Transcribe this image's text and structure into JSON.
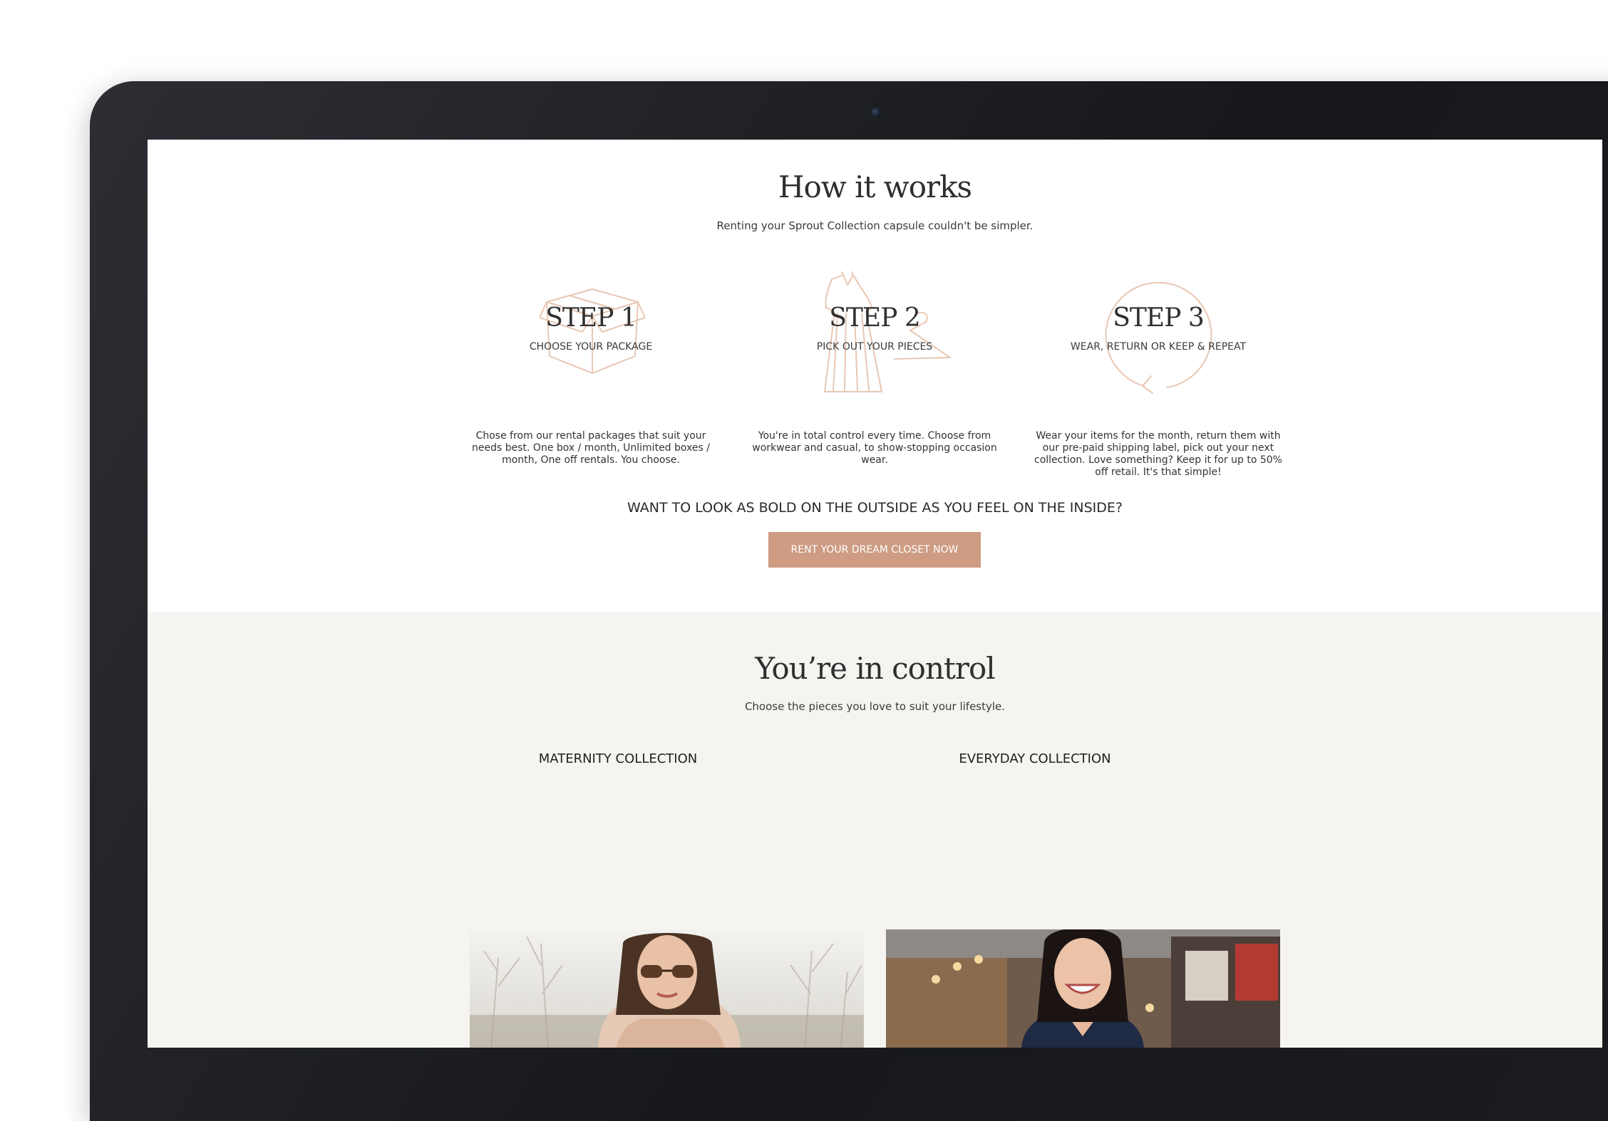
{
  "how_it_works": {
    "title": "How it works",
    "subtitle": "Renting your Sprout Collection capsule couldn't be simpler.",
    "steps": [
      {
        "heading": "STEP 1",
        "subheading": "CHOOSE YOUR PACKAGE",
        "icon": "box-icon",
        "description_lines": [
          "Chose from our rental packages that suit your",
          "needs best. One box / month, Unlimited boxes /",
          "month, One off rentals. You choose."
        ]
      },
      {
        "heading": "STEP 2",
        "subheading": "PICK OUT YOUR PIECES",
        "icon": "dress-icon",
        "description_lines": [
          "You're in total control every time. Choose from",
          "workwear and casual, to show-stopping occasion",
          "wear."
        ]
      },
      {
        "heading": "STEP 3",
        "subheading": "WEAR, RETURN OR KEEP & REPEAT",
        "icon": "cycle-arrow-icon",
        "description_lines": [
          "Wear your items for the month, return them with",
          "our pre-paid shipping label, pick out your next",
          "collection. Love something? Keep it for up to 50%",
          "off retail. It's that simple!"
        ]
      }
    ],
    "cta_question": "WANT TO LOOK AS BOLD ON THE OUTSIDE AS YOU FEEL ON THE INSIDE?",
    "cta_button": "RENT YOUR DREAM CLOSET NOW"
  },
  "control": {
    "title": "You’re in control",
    "subtitle": "Choose the pieces you love to suit your lifestyle.",
    "collections": [
      {
        "label": "MATERNITY COLLECTION"
      },
      {
        "label": "EVERYDAY COLLECTION"
      }
    ]
  },
  "colors": {
    "accent": "#cd9c83",
    "icon_stroke": "#e8c7b3",
    "section_bg": "#f5f4f1"
  }
}
